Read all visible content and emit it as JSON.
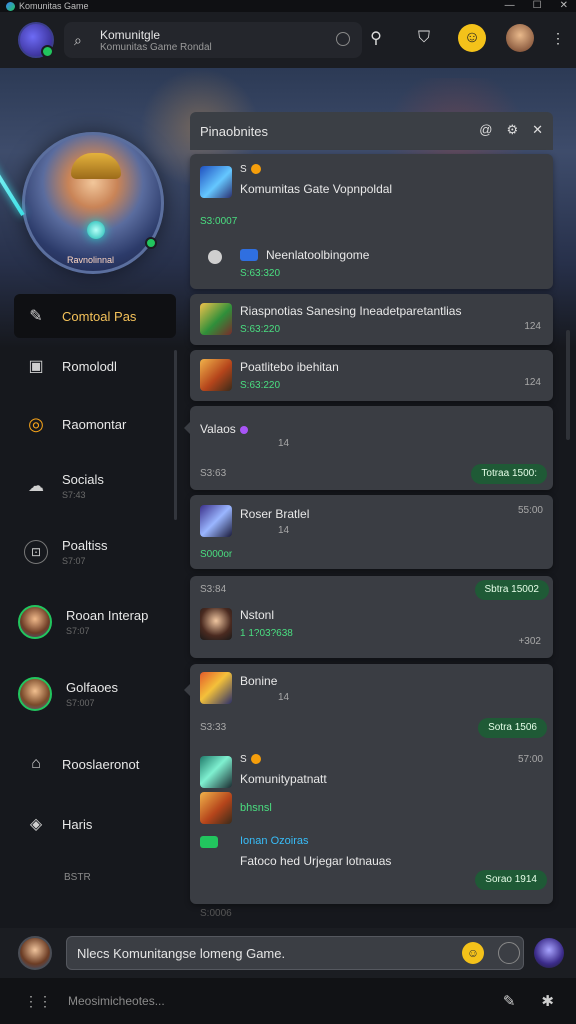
{
  "window": {
    "title": "Komunitas Game",
    "controls": [
      "—",
      "☐",
      "✕"
    ]
  },
  "topbar": {
    "search_title": "Komunitgle",
    "search_sub": "Komunitas Game Rondal",
    "icons": [
      "search-icon",
      "paint-bucket-icon",
      "smiley-gold-icon",
      "user-avatar",
      "more-icon"
    ]
  },
  "hero": {
    "name": "Ravnolinnal"
  },
  "sidebar": {
    "items": [
      {
        "label": "Comtoal Pas",
        "sub": "",
        "icon": "chat-bubble-icon"
      },
      {
        "label": "Romolodl",
        "sub": "",
        "icon": "store-icon"
      },
      {
        "label": "Raomontar",
        "sub": "",
        "icon": "gold-coin-icon"
      },
      {
        "label": "Socials",
        "sub": "S7:43",
        "icon": "cloud-icon"
      },
      {
        "label": "Poaltiss",
        "sub": "S7:07",
        "icon": "lock-icon"
      },
      {
        "label": "Rooan Interap",
        "sub": "S7:07",
        "icon": "avatar"
      },
      {
        "label": "Golfaoes",
        "sub": "S7:007",
        "icon": "avatar"
      },
      {
        "label": "Rooslaeronot",
        "sub": "",
        "icon": "tag-icon"
      },
      {
        "label": "Haris",
        "sub": "",
        "icon": "compass-icon"
      }
    ],
    "footer": "BSTR"
  },
  "panel": {
    "title": "Pinaobnites",
    "icons": [
      "at-icon",
      "settings-icon",
      "close-icon"
    ],
    "footer": "S:0006"
  },
  "cards": {
    "c1": {
      "line1": "S",
      "title": "Komumitas Gate Vopnpoldal",
      "meta": "S3:0007",
      "sub_title": "Neenlatoolbingome",
      "sub_meta": "S:63:320"
    },
    "c2": {
      "title": "Riaspnotias Sanesing Ineadetparetantlias",
      "meta": "S:63:220",
      "count": "124"
    },
    "c3": {
      "title": "Poatlitebo ibehitan",
      "meta": "S:63:220",
      "count": "124"
    },
    "c4": {
      "title": "Valaos",
      "count": "14",
      "time": "S3:63",
      "pill": "Totraa 1500:"
    },
    "c5": {
      "title": "Roser Bratlel",
      "count": "14",
      "meta": "S000or",
      "time": "55:00"
    },
    "c6": {
      "pill": "Sbtra 15002",
      "time": "S3:84",
      "title": "Nstonl",
      "meta": "1 1?03?638",
      "count": "+302"
    },
    "c7": {
      "title": "Bonine",
      "count": "14",
      "time": "S3:33",
      "pill": "Sotra 1506",
      "line2_top": "S",
      "line2_time": "57:00",
      "line2": "Komunitypatnatt",
      "line3": "bhsnsl",
      "line4": "Ionan Ozoiras",
      "line5": "Fatoco hed Urjegar lotnauas",
      "pill2": "Sorao 1914"
    }
  },
  "composer": {
    "avatar": "user-avatar",
    "placeholder": "Nlecs Komunitangse lomeng Game.",
    "emoji": "☺"
  },
  "bottombar": {
    "text": "Meosimicheotes...",
    "icons": [
      "grid-icon",
      "pin-icon",
      "settings-icon"
    ]
  },
  "colors": {
    "accent": "#f4c25a",
    "green": "#4ade80",
    "pill": "#1f5a36"
  }
}
